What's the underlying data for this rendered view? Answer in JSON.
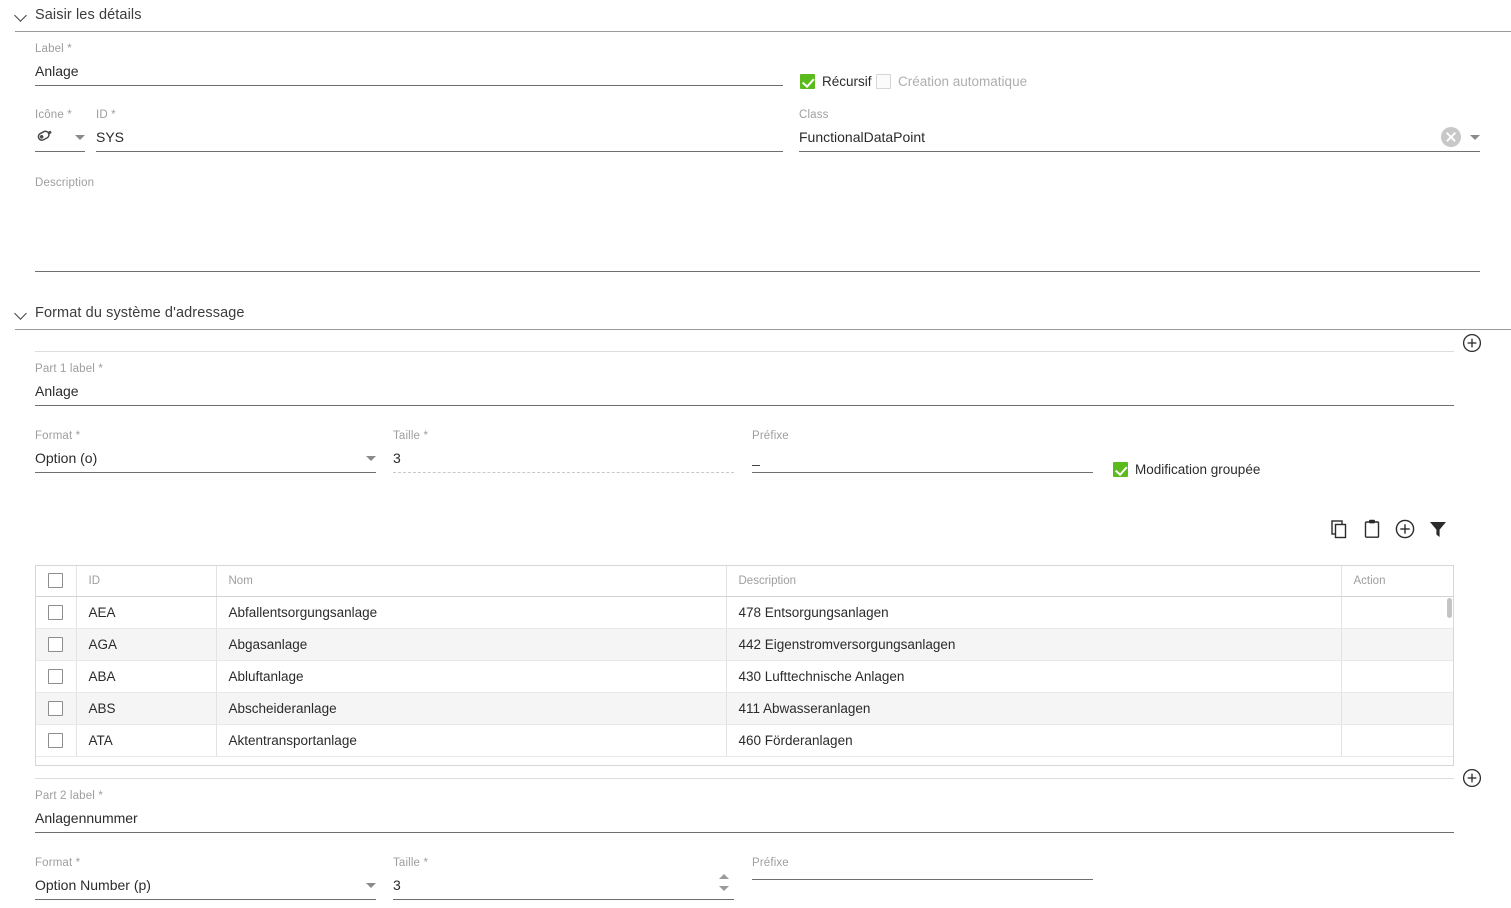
{
  "sections": {
    "details": {
      "title": "Saisir les détails"
    },
    "addressing": {
      "title": "Format du système d'adressage"
    }
  },
  "details": {
    "label_field": {
      "label": "Label *",
      "value": "Anlage"
    },
    "icon_field": {
      "label": "Icône *",
      "value": "",
      "icon": "tag-icon"
    },
    "id_field": {
      "label": "ID *",
      "value": "SYS"
    },
    "description_field": {
      "label": "Description",
      "value": ""
    },
    "recursive_checkbox": {
      "label": "Récursif",
      "checked": true
    },
    "autocreate_checkbox": {
      "label": "Création automatique",
      "checked": false,
      "disabled": true
    },
    "class_field": {
      "label": "Class",
      "value": "FunctionalDataPoint"
    }
  },
  "part1": {
    "label_field": {
      "label": "Part 1 label *",
      "value": "Anlage"
    },
    "format_field": {
      "label": "Format *",
      "value": "Option (o)"
    },
    "size_field": {
      "label": "Taille *",
      "value": "3"
    },
    "prefix_field": {
      "label": "Préfixe",
      "value": "_"
    },
    "bulk_edit_checkbox": {
      "label": "Modification groupée",
      "checked": true
    }
  },
  "part2": {
    "label_field": {
      "label": "Part 2 label *",
      "value": "Anlagennummer"
    },
    "format_field": {
      "label": "Format *",
      "value": "Option Number (p)"
    },
    "size_field": {
      "label": "Taille *",
      "value": "3"
    },
    "prefix_field": {
      "label": "Préfixe",
      "value": ""
    }
  },
  "toolbar": {
    "copy": "copy-icon",
    "paste": "paste-icon",
    "add": "add-circle-icon",
    "filter": "filter-icon"
  },
  "add_buttons": {
    "top": "add-circle-icon",
    "bottom": "add-circle-icon"
  },
  "table": {
    "columns": [
      "",
      "ID",
      "Nom",
      "Description",
      "Action"
    ],
    "rows": [
      {
        "id": "AEA",
        "nom": "Abfallentsorgungsanlage",
        "description": "478 Entsorgungsanlagen",
        "action": ""
      },
      {
        "id": "AGA",
        "nom": "Abgasanlage",
        "description": "442 Eigenstromversorgungsanlagen",
        "action": ""
      },
      {
        "id": "ABA",
        "nom": "Abluftanlage",
        "description": "430 Lufttechnische Anlagen",
        "action": ""
      },
      {
        "id": "ABS",
        "nom": "Abscheideranlage",
        "description": "411 Abwasseranlagen",
        "action": ""
      },
      {
        "id": "ATA",
        "nom": "Aktentransportanlage",
        "description": "460 Förderanlagen",
        "action": ""
      }
    ]
  },
  "colors": {
    "accent_green": "#5cbb1c",
    "label_gray": "#9e9e9e",
    "text": "#2b2b2b",
    "rule": "#9a9a9a"
  }
}
